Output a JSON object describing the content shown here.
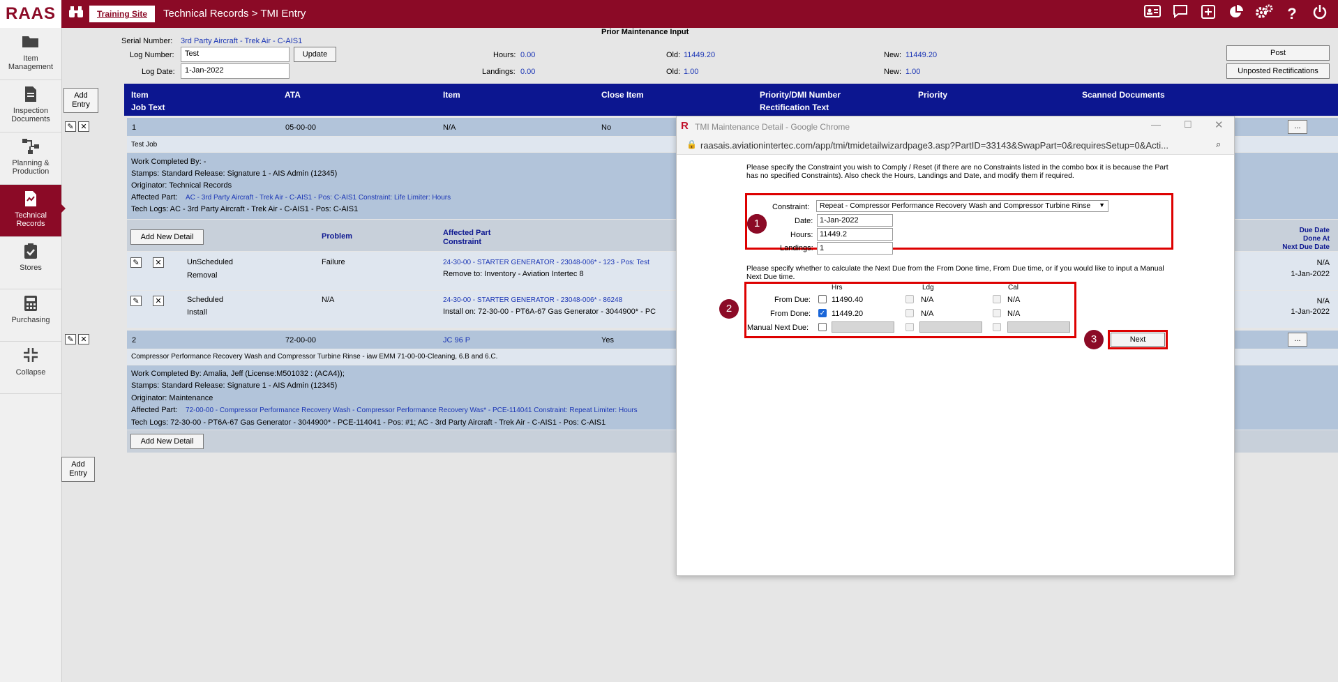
{
  "app": {
    "logo": "RAAS",
    "site_tab": "Training Site",
    "breadcrumb": "Technical Records > TMI Entry"
  },
  "topbar_icons": [
    "id-card-icon",
    "chat-icon",
    "plus-square-icon",
    "pie-chart-icon",
    "gears-icon",
    "help-icon",
    "power-icon"
  ],
  "sidebar": {
    "items": [
      {
        "label": "Item Management",
        "icon": "folder-icon"
      },
      {
        "label": "Inspection Documents",
        "icon": "document-icon"
      },
      {
        "label": "Planning & Production",
        "icon": "flow-icon"
      },
      {
        "label": "Technical Records",
        "icon": "records-icon",
        "active": true
      },
      {
        "label": "Stores",
        "icon": "clipboard-check-icon"
      },
      {
        "label": "Purchasing",
        "icon": "calculator-icon"
      },
      {
        "label": "Collapse",
        "icon": "collapse-icon"
      }
    ]
  },
  "header": {
    "serial_label": "Serial Number:",
    "serial_value": "3rd Party Aircraft - Trek Air - C-AIS1",
    "prior_title": "Prior Maintenance Input",
    "log_number_label": "Log Number:",
    "log_number_value": "Test",
    "update_button": "Update",
    "log_date_label": "Log Date:",
    "log_date_value": "1-Jan-2022",
    "hours_label": "Hours:",
    "hours_value": "0.00",
    "landings_label": "Landings:",
    "landings_value": "0.00",
    "old_label": "Old:",
    "old_hours": "11449.20",
    "old_landings": "1.00",
    "new_label": "New:",
    "new_hours": "11449.20",
    "new_landings": "1.00",
    "post_button": "Post",
    "unposted_button": "Unposted Rectifications"
  },
  "grid": {
    "add_entry": "Add Entry",
    "headers": {
      "item": "Item",
      "job_text": "Job Text",
      "ata": "ATA",
      "item2": "Item",
      "close_item": "Close Item",
      "priority_dmi": "Priority/DMI Number",
      "rect_text": "Rectification Text",
      "priority": "Priority",
      "scanned": "Scanned Documents"
    },
    "entry1": {
      "num": "1",
      "ata": "05-00-00",
      "item": "N/A",
      "close": "No",
      "job_text": "Test Job",
      "work_completed": "Work Completed By: -",
      "stamps": "Stamps: Standard Release: Signature 1 - AIS Admin (12345)",
      "originator": "Originator: Technical Records",
      "affected_label": "Affected Part:",
      "affected_value": "AC - 3rd Party Aircraft - Trek Air - C-AIS1 - Pos: C-AIS1 Constraint: Life Limiter: Hours",
      "tech_logs": "Tech Logs: AC - 3rd Party Aircraft - Trek Air - C-AIS1 - Pos: C-AIS1",
      "add_detail": "Add New Detail",
      "detail_headers": {
        "problem": "Problem",
        "affected_part": "Affected Part",
        "constraint": "Constraint",
        "due_date": "Due Date",
        "done_at": "Done At",
        "next_due": "Next Due Date"
      },
      "details": [
        {
          "type1": "UnScheduled",
          "type2": "Removal",
          "problem": "Failure",
          "part": "24-30-00 - STARTER GENERATOR - 23048-006* - 123 - Pos: Test",
          "note": "Remove to: Inventory - Aviation Intertec 8",
          "right1": "N/A",
          "right2": "1-Jan-2022"
        },
        {
          "type1": "Scheduled",
          "type2": "Install",
          "problem": "N/A",
          "part": "24-30-00 - STARTER GENERATOR - 23048-006* - 86248",
          "note": "Install on: 72-30-00 - PT6A-67 Gas Generator - 3044900* - PC",
          "right1": "N/A",
          "right2": "1-Jan-2022"
        }
      ]
    },
    "entry2": {
      "num": "2",
      "ata": "72-00-00",
      "item": "JC 96 P",
      "close": "Yes",
      "job_text": "Compressor Performance Recovery Wash and Compressor Turbine Rinse - iaw EMM 71-00-00-Cleaning, 6.B and 6.C.",
      "work_completed": "Work Completed By: Amalia, Jeff (License:M501032 : (ACA4));",
      "stamps": "Stamps: Standard Release: Signature 1 - AIS Admin (12345)",
      "originator": "Originator: Maintenance",
      "affected_label": "Affected Part:",
      "affected_value": "72-00-00 - Compressor Performance Recovery Wash - Compressor Performance Recovery Was* - PCE-114041 Constraint: Repeat Limiter: Hours",
      "tech_logs": "Tech Logs: 72-30-00 - PT6A-67 Gas Generator - 3044900* - PCE-114041 - Pos: #1; AC - 3rd Party Aircraft - Trek Air - C-AIS1 - Pos: C-AIS1",
      "add_detail": "Add New Detail"
    },
    "ellipsis": "...",
    "add_entry_bottom": "Add Entry"
  },
  "dialog": {
    "title": "TMI Maintenance Detail - Google Chrome",
    "url": "raasais.aviationintertec.com/app/tmi/tmidetailwizardpage3.asp?PartID=33143&SwapPart=0&requiresSetup=0&Acti...",
    "intro": "Please specify the Constraint you wish to Comply / Reset (if there are no Constraints listed in the combo box it is because the Part has no specified Constraints). Also check the Hours, Landings and Date, and modify them if required.",
    "constraint_label": "Constraint:",
    "constraint_value": "Repeat - Compressor Performance Recovery Wash and Compressor Turbine Rinse",
    "date_label": "Date:",
    "date_value": "1-Jan-2022",
    "hours_label": "Hours:",
    "hours_value": "11449.2",
    "landings_label": "Landings:",
    "landings_value": "1",
    "calc_text": "Please specify whether to calculate the Next Due from the From Done time, From Due time, or if you would like to input a Manual Next Due time.",
    "col_hrs": "Hrs",
    "col_ldg": "Ldg",
    "col_cal": "Cal",
    "from_due_label": "From Due:",
    "from_due_hrs": "11490.40",
    "from_due_ldg": "N/A",
    "from_due_cal": "N/A",
    "from_done_label": "From Done:",
    "from_done_hrs": "11449.20",
    "from_done_ldg": "N/A",
    "from_done_cal": "N/A",
    "manual_label": "Manual Next Due:",
    "next_button": "Next",
    "step1": "1",
    "step2": "2",
    "step3": "3"
  },
  "colors": {
    "brand": "#8b0a26",
    "grid_header": "#0c1690",
    "link": "#1a35b5",
    "highlight": "#dd0000"
  }
}
